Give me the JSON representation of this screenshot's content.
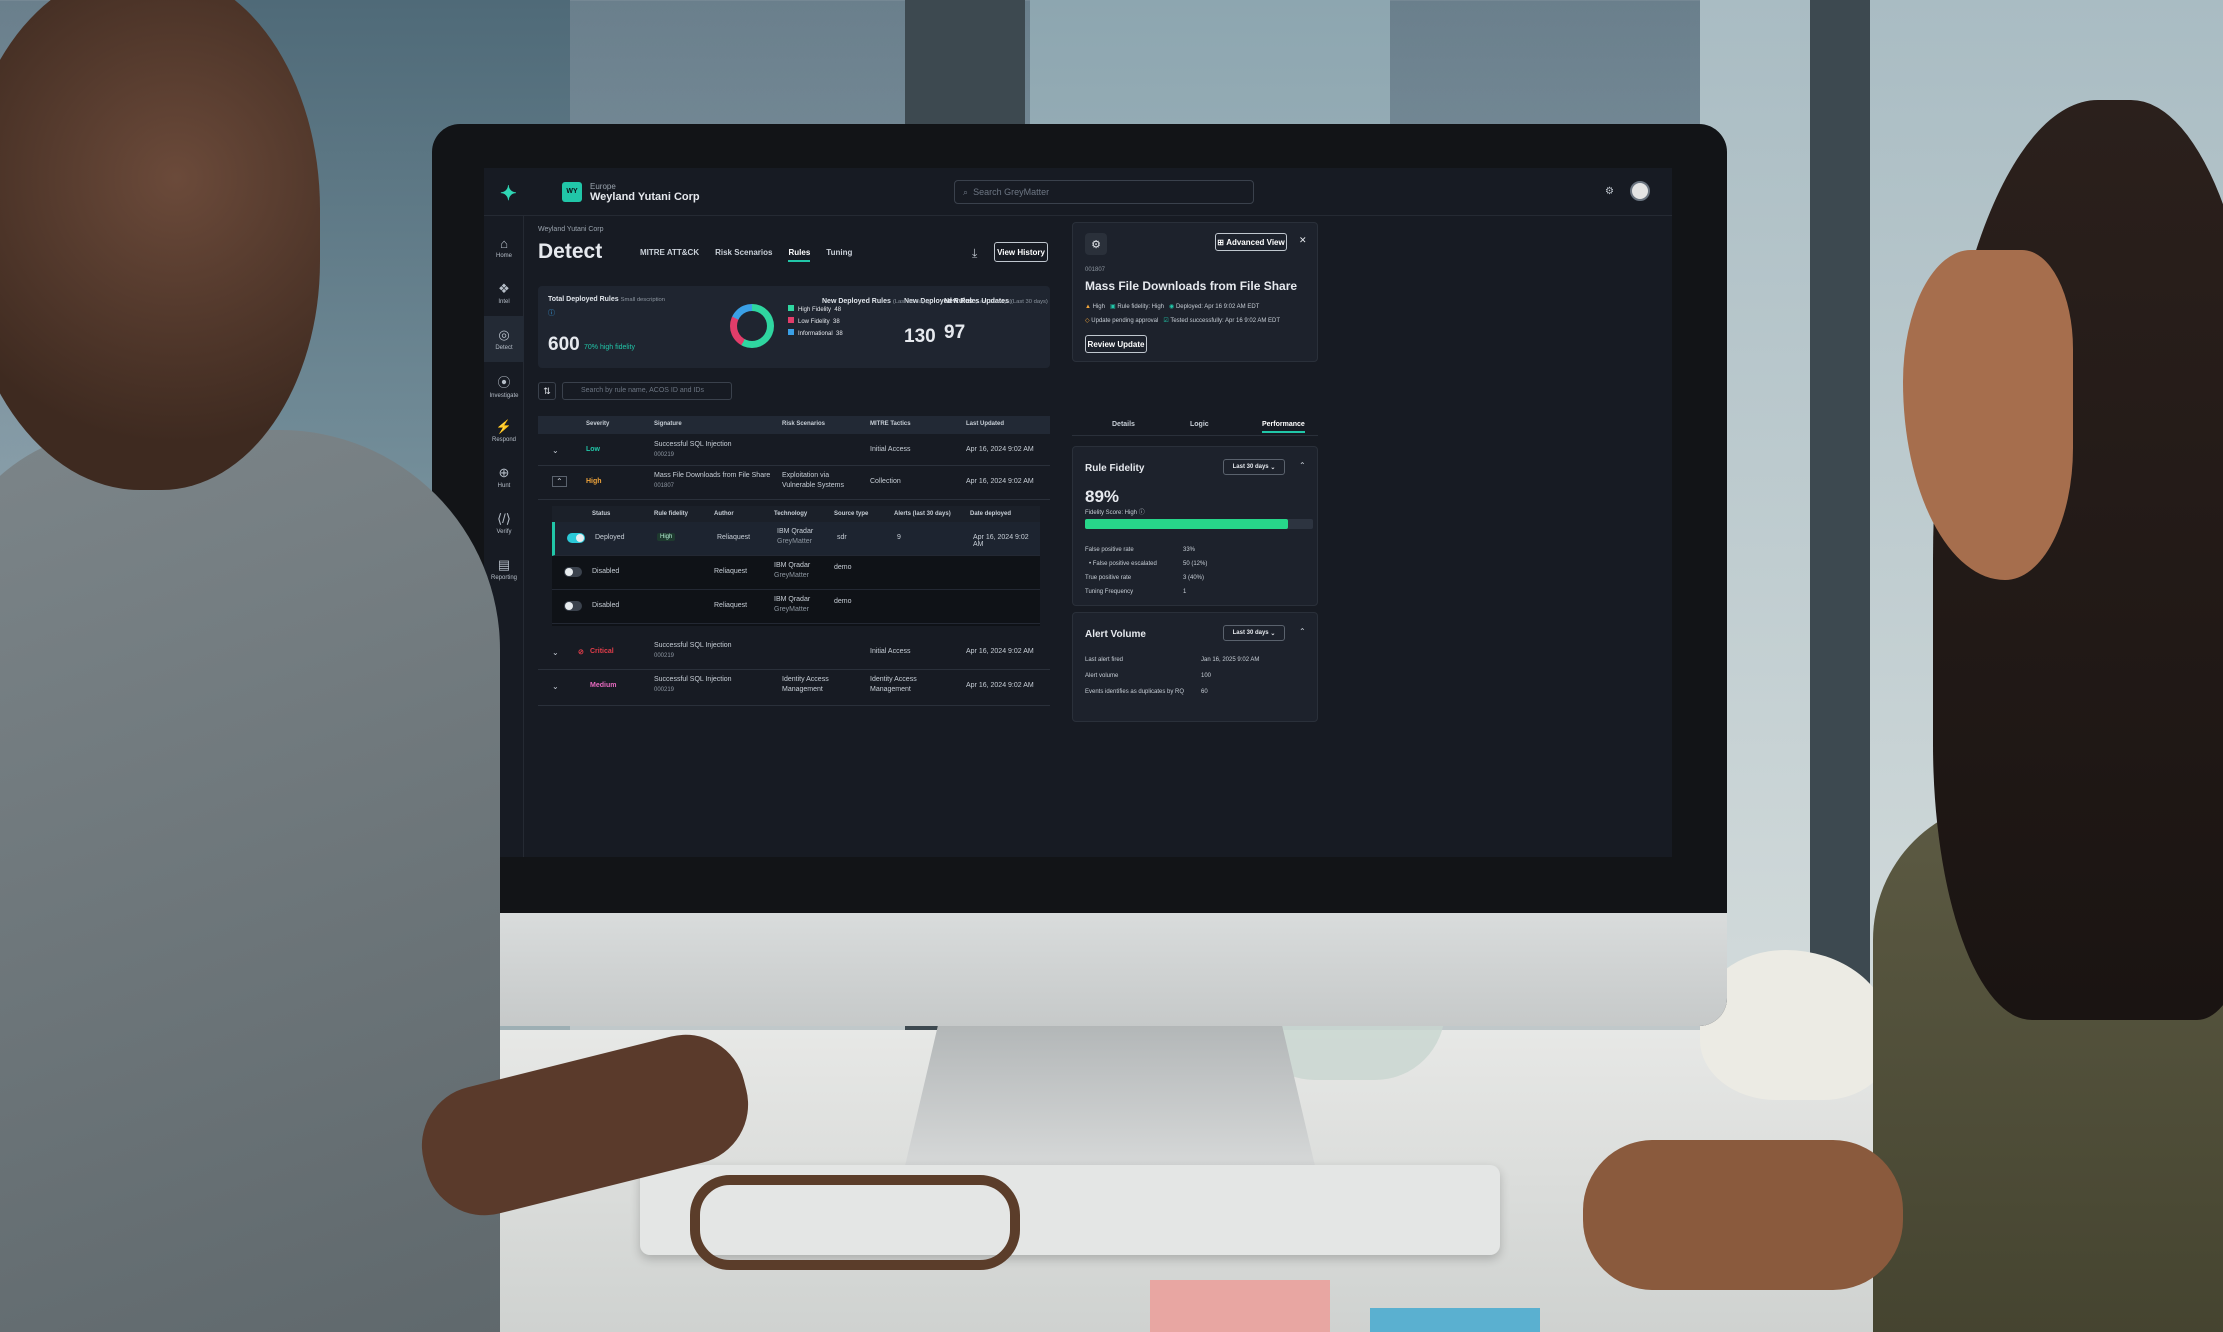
{
  "app": {
    "org_badge": "WY",
    "org_region": "Europe",
    "org_name": "Weyland Yutani Corp",
    "search_placeholder": "Search GreyMatter",
    "accent": "#21c6a8"
  },
  "nav": [
    {
      "label": "Home",
      "icon": "home-icon"
    },
    {
      "label": "Intel",
      "icon": "intel-icon"
    },
    {
      "label": "Detect",
      "icon": "detect-icon"
    },
    {
      "label": "Investigate",
      "icon": "investigate-icon"
    },
    {
      "label": "Respond",
      "icon": "respond-icon"
    },
    {
      "label": "Hunt",
      "icon": "hunt-icon"
    },
    {
      "label": "Verify",
      "icon": "verify-icon"
    },
    {
      "label": "Reporting",
      "icon": "reporting-icon"
    }
  ],
  "page": {
    "breadcrumb": "Weyland Yutani Corp",
    "title": "Detect",
    "tabs": [
      "MITRE ATT&CK",
      "Risk Scenarios",
      "Rules",
      "Tuning"
    ],
    "active_tab": "Rules",
    "view_history": "View History"
  },
  "stats": {
    "total_label": "Total Deployed Rules",
    "total_desc": "Small description",
    "total_value": "600",
    "total_sub": "70% high fidelity",
    "legend": [
      {
        "label": "High Fidelity",
        "value": "48",
        "color": "#2fd6a0"
      },
      {
        "label": "Low Fidelity",
        "value": "38",
        "color": "#e23d6a"
      },
      {
        "label": "Informational",
        "value": "38",
        "color": "#3aa0e6"
      }
    ],
    "new_label": "New Deployed Rules",
    "new_range": "(Last 30 days)",
    "new_value": "130",
    "updates_label": "New Rules Updates",
    "updates_range": "(Last 30 days)",
    "updates_value": "97"
  },
  "filter": {
    "placeholder": "Search by rule name, ACOS ID and IDs"
  },
  "table": {
    "headers": [
      "Severity",
      "Signature",
      "Risk Scenarios",
      "MITRE Tactics",
      "Last Updated"
    ],
    "rows": [
      {
        "severity": "Low",
        "signature": "Successful SQL Injection",
        "id": "000219",
        "risk": "",
        "risk2": "",
        "tactic": "Initial Access",
        "tactic2": "",
        "updated": "Apr 16, 2024 9:02 AM",
        "sev_color": "#21c6a8"
      },
      {
        "severity": "High",
        "signature": "Mass File Downloads from File Share",
        "id": "001807",
        "risk": "Exploitation via",
        "risk2": "Vulnerable Systems",
        "tactic": "Collection",
        "tactic2": "",
        "updated": "Apr 16, 2024 9:02 AM",
        "sev_color": "#f0a43a"
      },
      {
        "severity": "Critical",
        "signature": "Successful SQL Injection",
        "id": "000219",
        "risk": "",
        "risk2": "",
        "tactic": "Initial Access",
        "tactic2": "",
        "updated": "Apr 16, 2024 9:02 AM",
        "sev_color": "#e23d4a"
      },
      {
        "severity": "Medium",
        "signature": "Successful SQL Injection",
        "id": "000219",
        "risk": "Identity Access",
        "risk2": "Management",
        "tactic": "Identity Access",
        "tactic2": "Management",
        "updated": "Apr 16, 2024 9:02 AM",
        "sev_color": "#e86ac0"
      }
    ]
  },
  "subtable": {
    "headers": [
      "Status",
      "Rule fidelity",
      "Author",
      "Technology",
      "Source type",
      "Alerts (last 30 days)",
      "Date deployed"
    ],
    "rows": [
      {
        "status": "Deployed",
        "fidelity": "High",
        "author": "Reliaquest",
        "tech": "IBM Qradar",
        "tech2": "GreyMatter",
        "source": "sdr",
        "alerts": "9",
        "date": "Apr 16, 2024 9:02 AM",
        "on": true
      },
      {
        "status": "Disabled",
        "fidelity": "",
        "author": "Reliaquest",
        "tech": "IBM Qradar",
        "tech2": "GreyMatter",
        "source": "demo",
        "alerts": "",
        "date": "",
        "on": false
      },
      {
        "status": "Disabled",
        "fidelity": "",
        "author": "Reliaquest",
        "tech": "IBM Qradar",
        "tech2": "GreyMatter",
        "source": "demo",
        "alerts": "",
        "date": "",
        "on": false
      }
    ]
  },
  "detail": {
    "advanced_view": "Advanced View",
    "id": "001807",
    "title": "Mass File Downloads from File Share",
    "meta1": [
      "High",
      "Rule fidelity: High",
      "Deployed: Apr 16 9:02 AM EDT"
    ],
    "meta2": [
      "Update pending approval",
      "Tested successfully: Apr 16 9:02 AM EDT"
    ],
    "review_button": "Review Update",
    "tabs": [
      "Details",
      "Logic",
      "Performance"
    ],
    "active_tab": "Performance"
  },
  "fidelity": {
    "title": "Rule Fidelity",
    "range": "Last 30 days",
    "value": "89%",
    "score_label": "Fidelity Score: High",
    "bar_fraction": 0.89,
    "rows": [
      {
        "k": "False positive rate",
        "v": "33%"
      },
      {
        "k": "• False positive escalated",
        "v": "50 (12%)"
      },
      {
        "k": "True positive rate",
        "v": "3 (40%)"
      },
      {
        "k": "Tuning Frequency",
        "v": "1"
      }
    ]
  },
  "volume": {
    "title": "Alert Volume",
    "range": "Last 30 days",
    "rows": [
      {
        "k": "Last alert fired",
        "v": "Jan 16, 2025 9:02 AM"
      },
      {
        "k": "Alert volume",
        "v": "100"
      },
      {
        "k": "Events identifies as duplicates by RQ",
        "v": "60"
      }
    ]
  }
}
